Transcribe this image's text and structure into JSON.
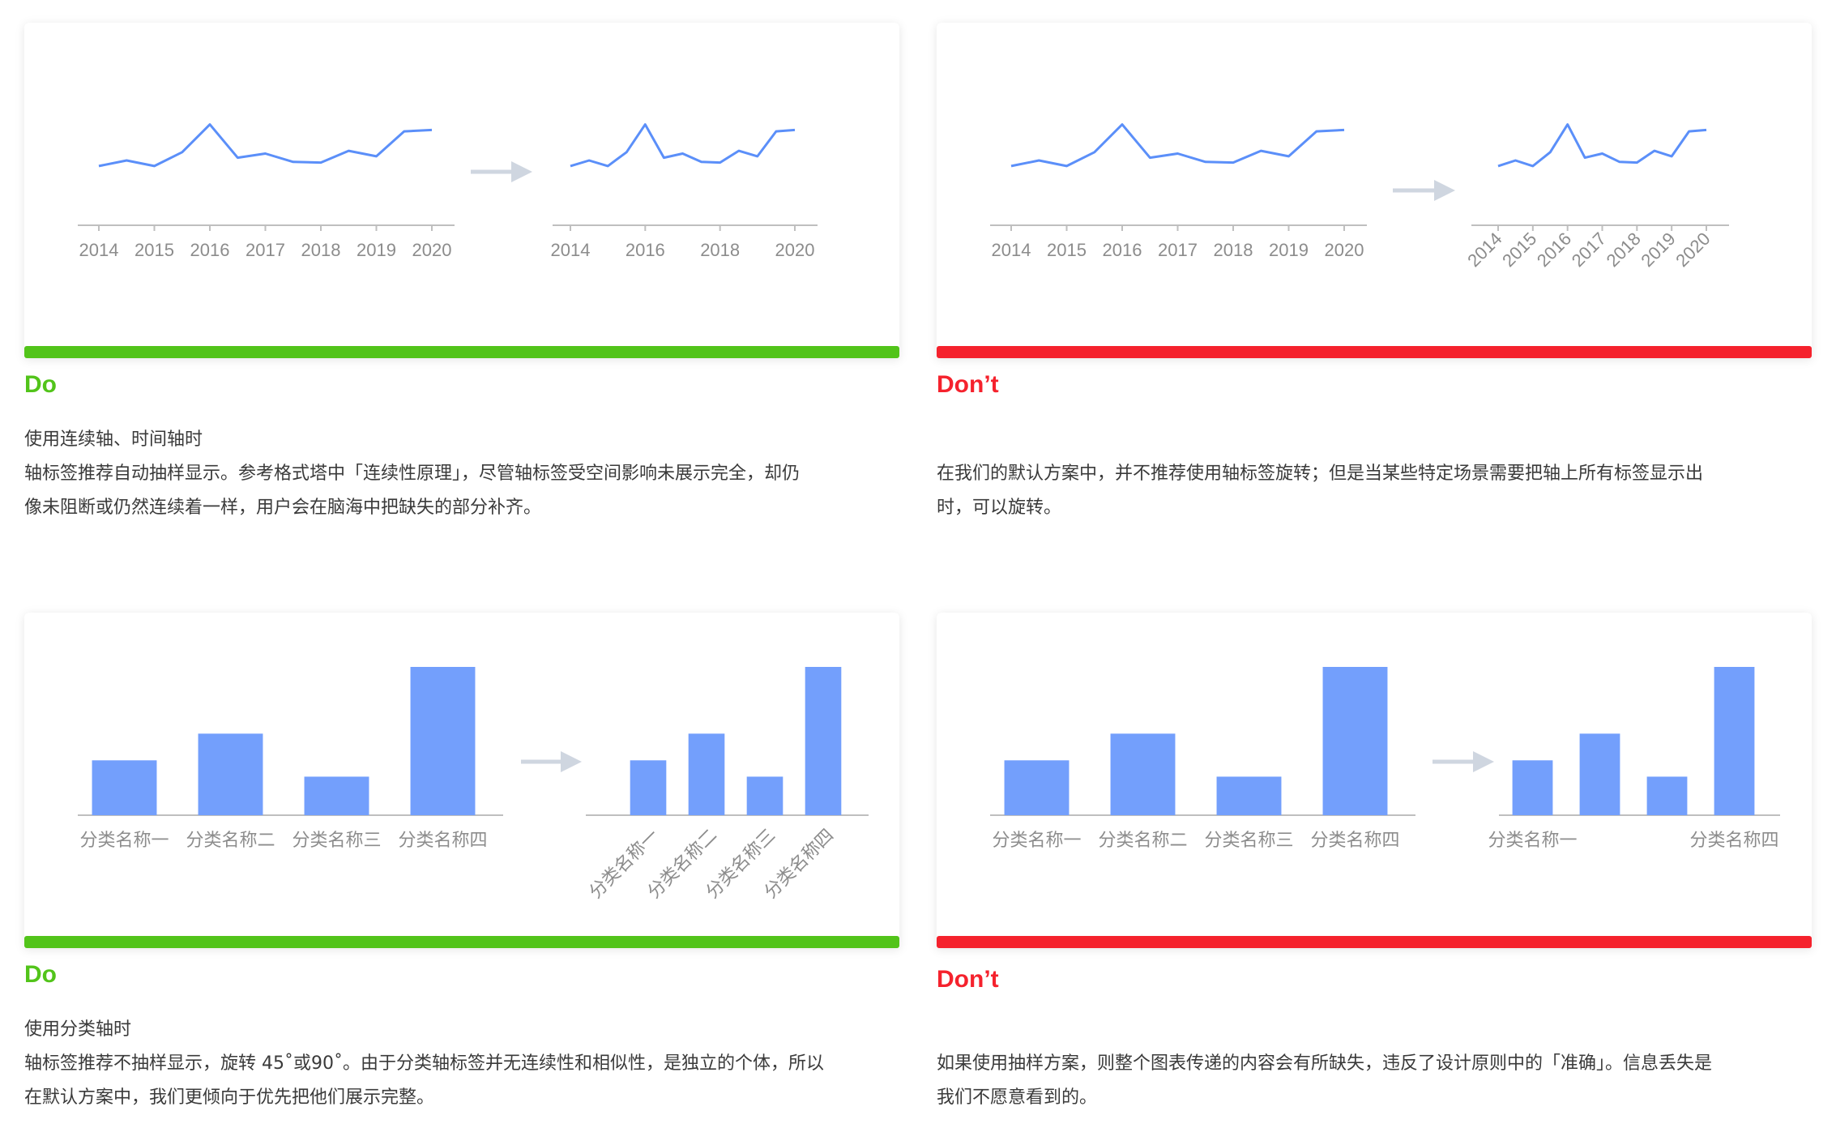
{
  "panels": {
    "p1": {
      "verdict": "Do",
      "lines": [
        "使用连续轴、时间轴时",
        "轴标签推荐自动抽样显示。参考格式塔中「连续性原理」，尽管轴标签受空间影响未展示完全，却仍",
        "像未阻断或仍然连续着一样，用户会在脑海中把缺失的部分补齐。"
      ]
    },
    "p2": {
      "verdict": "Don’t",
      "lines": [
        "",
        "在我们的默认方案中，并不推荐使用轴标签旋转；但是当某些特定场景需要把轴上所有标签显示出",
        "时，可以旋转。"
      ]
    },
    "p3": {
      "verdict": "Do",
      "lines": [
        "使用分类轴时",
        "轴标签推荐不抽样显示，旋转 45˚或90˚。由于分类轴标签并无连续性和相似性，是独立的个体，所以",
        "在默认方案中，我们更倾向于优先把他们展示完整。"
      ]
    },
    "p4": {
      "verdict": "Don’t",
      "lines": [
        "",
        "如果使用抽样方案，则整个图表传递的内容会有所缺失，违反了设计原则中的「准确」。信息丢失是",
        "我们不愿意看到的。"
      ]
    }
  },
  "colors": {
    "good": "#52c41a",
    "bad": "#f5222d",
    "series": "#5b8ff9",
    "bar": "#739ffc",
    "axis": "#bfbfbf",
    "arrow": "#cfd6e0"
  },
  "chart_data": [
    {
      "type": "line",
      "panel": "p1-left",
      "x": [
        "2014-01",
        "2014-07",
        "2015-01",
        "2015-07",
        "2016-01",
        "2016-07",
        "2017-01",
        "2017-07",
        "2018-01",
        "2018-07",
        "2019-01",
        "2019-07",
        "2020-01"
      ],
      "values": [
        10,
        14,
        10,
        20,
        40,
        16,
        19,
        13,
        12.5,
        21,
        17,
        35,
        36
      ],
      "tick_labels": [
        "2014",
        "2015",
        "2016",
        "2017",
        "2018",
        "2019",
        "2020"
      ],
      "ylim": [
        0,
        45
      ]
    },
    {
      "type": "line",
      "panel": "p1-right",
      "x": [
        "2014-01",
        "2014-07",
        "2015-01",
        "2015-07",
        "2016-01",
        "2016-07",
        "2017-01",
        "2017-07",
        "2018-01",
        "2018-07",
        "2019-01",
        "2019-07",
        "2020-01"
      ],
      "values": [
        10,
        14,
        10,
        20,
        40,
        16,
        19,
        13,
        12.5,
        21,
        17,
        35,
        36
      ],
      "tick_labels": [
        "2014",
        "2016",
        "2018",
        "2020"
      ],
      "ylim": [
        0,
        45
      ]
    },
    {
      "type": "line",
      "panel": "p2-left",
      "x": [
        "2014-01",
        "2014-07",
        "2015-01",
        "2015-07",
        "2016-01",
        "2016-07",
        "2017-01",
        "2017-07",
        "2018-01",
        "2018-07",
        "2019-01",
        "2019-07",
        "2020-01"
      ],
      "values": [
        10,
        14,
        10,
        20,
        40,
        16,
        19,
        13,
        12.5,
        21,
        17,
        35,
        36
      ],
      "tick_labels": [
        "2014",
        "2015",
        "2016",
        "2017",
        "2018",
        "2019",
        "2020"
      ],
      "ylim": [
        0,
        45
      ]
    },
    {
      "type": "line",
      "panel": "p2-right",
      "x": [
        "2014-01",
        "2014-07",
        "2015-01",
        "2015-07",
        "2016-01",
        "2016-07",
        "2017-01",
        "2017-07",
        "2018-01",
        "2018-07",
        "2019-01",
        "2019-07",
        "2020-01"
      ],
      "values": [
        10,
        14,
        10,
        20,
        40,
        16,
        19,
        13,
        12.5,
        21,
        17,
        35,
        36
      ],
      "tick_labels": [
        "2014",
        "2015",
        "2016",
        "2017",
        "2018",
        "2019",
        "2020"
      ],
      "tick_rotation": -45,
      "ylim": [
        0,
        45
      ]
    },
    {
      "type": "bar",
      "panel": "p3-left",
      "categories": [
        "分类名称一",
        "分类名称二",
        "分类名称三",
        "分类名称四"
      ],
      "values": [
        37,
        55,
        26,
        100
      ],
      "ylim": [
        0,
        100
      ]
    },
    {
      "type": "bar",
      "panel": "p3-right",
      "categories": [
        "分类名称一",
        "分类名称二",
        "分类名称三",
        "分类名称四"
      ],
      "values": [
        37,
        55,
        26,
        100
      ],
      "tick_rotation": -45,
      "ylim": [
        0,
        100
      ]
    },
    {
      "type": "bar",
      "panel": "p4-left",
      "categories": [
        "分类名称一",
        "分类名称二",
        "分类名称三",
        "分类名称四"
      ],
      "values": [
        37,
        55,
        26,
        100
      ],
      "ylim": [
        0,
        100
      ]
    },
    {
      "type": "bar",
      "panel": "p4-right",
      "categories": [
        "分类名称一",
        "分类名称二",
        "分类名称三",
        "分类名称四"
      ],
      "values": [
        37,
        55,
        26,
        100
      ],
      "tick_labels": [
        "分类名称一",
        "",
        "",
        "分类名称四"
      ],
      "ylim": [
        0,
        100
      ]
    }
  ]
}
